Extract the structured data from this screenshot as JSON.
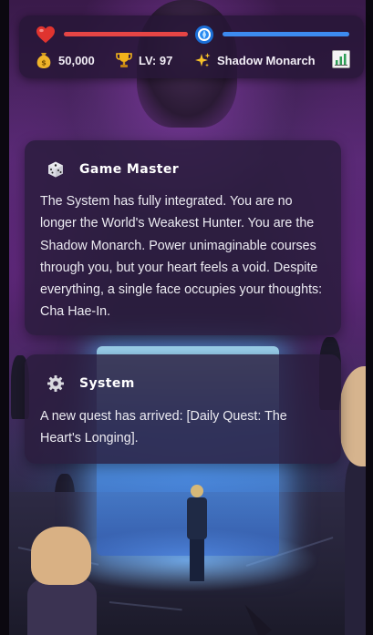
{
  "hud": {
    "hp_fraction": 1.0,
    "mp_fraction": 1.0,
    "gold": "50,000",
    "level": "LV: 97",
    "player_class": "Shadow Monarch",
    "icons": {
      "hp": "heart-icon",
      "mp": "mana-orb-icon",
      "gold": "money-bag-icon",
      "level": "trophy-icon",
      "class": "sparkles-icon",
      "stats": "bar-chart-icon"
    },
    "colors": {
      "hp": "#e64545",
      "mp": "#3d8bf0"
    }
  },
  "messages": [
    {
      "sender": "Game Master",
      "icon": "dice-icon",
      "text": "The System has fully integrated. You are no longer the World's Weakest Hunter. You are the Shadow Monarch. Power unimaginable courses through you, but your heart feels a void. Despite everything, a single face occupies your thoughts: Cha Hae-In."
    },
    {
      "sender": "System",
      "icon": "gear-icon",
      "text": "A new quest has arrived: [Daily Quest: The Heart's Longing]."
    }
  ]
}
